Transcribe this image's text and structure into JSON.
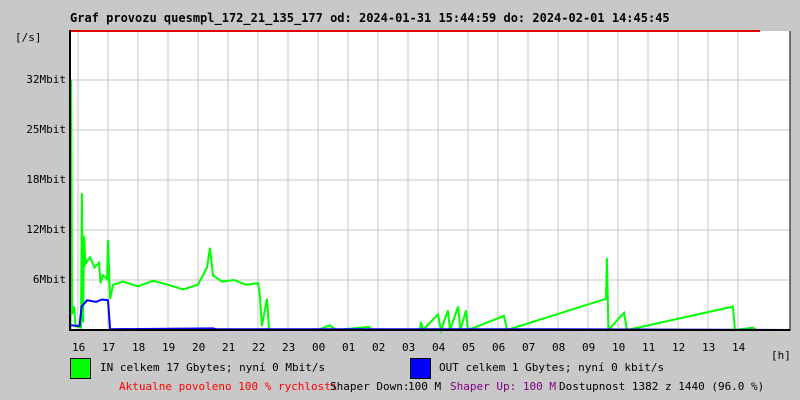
{
  "chart_data": {
    "type": "line",
    "title": "Graf provozu quesmpl_172_21_135_177 od: 2024-01-31 15:44:59 do: 2024-02-01 14:45:45",
    "ylabel": "[/s]",
    "xlabel": "[h]",
    "yticks": [
      {
        "label": "6Mbit",
        "value": 6.4
      },
      {
        "label": "12Mbit",
        "value": 12.8
      },
      {
        "label": "18Mbit",
        "value": 19.2
      },
      {
        "label": "25Mbit",
        "value": 25.6
      },
      {
        "label": "32Mbit",
        "value": 32
      }
    ],
    "ylim": [
      0,
      38
    ],
    "xlim_hours_from_16": [
      -0.25,
      23.73
    ],
    "xticks": [
      "16",
      "17",
      "18",
      "19",
      "20",
      "21",
      "22",
      "23",
      "00",
      "01",
      "02",
      "03",
      "04",
      "05",
      "06",
      "07",
      "08",
      "09",
      "10",
      "11",
      "12",
      "13",
      "14"
    ],
    "grid": true,
    "series": [
      {
        "name": "IN",
        "color": "#00ff00",
        "points": [
          [
            -0.25,
            0
          ],
          [
            -0.23,
            32
          ],
          [
            -0.2,
            2
          ],
          [
            -0.13,
            3
          ],
          [
            -0.08,
            0.5
          ],
          [
            0.1,
            0.3
          ],
          [
            0.13,
            17.5
          ],
          [
            0.17,
            1
          ],
          [
            0.2,
            12
          ],
          [
            0.25,
            8.5
          ],
          [
            0.4,
            9.3
          ],
          [
            0.55,
            8
          ],
          [
            0.7,
            8.6
          ],
          [
            0.75,
            6
          ],
          [
            0.83,
            7
          ],
          [
            0.97,
            6.5
          ],
          [
            1.0,
            11.5
          ],
          [
            1.07,
            4
          ],
          [
            1.17,
            5.8
          ],
          [
            1.5,
            6.2
          ],
          [
            2.0,
            5.6
          ],
          [
            2.5,
            6.3
          ],
          [
            3.0,
            5.8
          ],
          [
            3.5,
            5.2
          ],
          [
            4.0,
            5.8
          ],
          [
            4.3,
            8
          ],
          [
            4.4,
            10.5
          ],
          [
            4.5,
            7
          ],
          [
            4.8,
            6.2
          ],
          [
            5.2,
            6.4
          ],
          [
            5.6,
            5.8
          ],
          [
            6.0,
            6.0
          ],
          [
            6.05,
            5
          ],
          [
            6.13,
            0.5
          ],
          [
            6.3,
            4
          ],
          [
            6.37,
            0
          ],
          [
            8.0,
            0
          ],
          [
            8.4,
            0.6
          ],
          [
            8.6,
            0
          ],
          [
            9.7,
            0.4
          ],
          [
            9.8,
            0
          ],
          [
            11.4,
            0
          ],
          [
            11.43,
            1
          ],
          [
            11.5,
            0
          ],
          [
            12.0,
            2
          ],
          [
            12.1,
            0
          ],
          [
            12.33,
            2.5
          ],
          [
            12.4,
            0
          ],
          [
            12.67,
            3
          ],
          [
            12.75,
            0
          ],
          [
            12.93,
            2.5
          ],
          [
            13.0,
            0
          ],
          [
            14.2,
            1.8
          ],
          [
            14.3,
            0
          ],
          [
            17.6,
            4
          ],
          [
            17.63,
            9.2
          ],
          [
            17.68,
            0
          ],
          [
            18.2,
            2.2
          ],
          [
            18.3,
            0
          ],
          [
            21.83,
            3
          ],
          [
            21.9,
            0
          ],
          [
            22.5,
            0.3
          ],
          [
            22.6,
            0
          ],
          [
            23.73,
            0
          ]
        ]
      },
      {
        "name": "OUT",
        "color": "#0000ff",
        "points": [
          [
            -0.25,
            0.6
          ],
          [
            0.05,
            0.5
          ],
          [
            0.12,
            3
          ],
          [
            0.3,
            3.8
          ],
          [
            0.6,
            3.6
          ],
          [
            0.8,
            3.9
          ],
          [
            1.0,
            3.8
          ],
          [
            1.07,
            0.1
          ],
          [
            4.5,
            0.2
          ],
          [
            4.6,
            0.1
          ],
          [
            15.5,
            0.1
          ],
          [
            23.73,
            0
          ]
        ]
      }
    ]
  },
  "legend": {
    "in_text": "IN celkem 17 Gbytes; nyní 0 Mbit/s",
    "out_text": "OUT celkem 1 Gbytes; nyní 0 kbit/s"
  },
  "footer": {
    "allowed": "Aktualne povoleno 100 % rychlosti",
    "shaper_down_label": "Shaper Down:",
    "shaper_down_value": "100 M",
    "shaper_up": "Shaper Up: 100 M",
    "availability": "Dostupnost 1382 z 1440 (96.0 %)"
  },
  "colors": {
    "in": "#00ff00",
    "out": "#0000ff",
    "allowed": "#ff0000",
    "shaper_up": "#800080",
    "grid": "#c8c8c8"
  }
}
